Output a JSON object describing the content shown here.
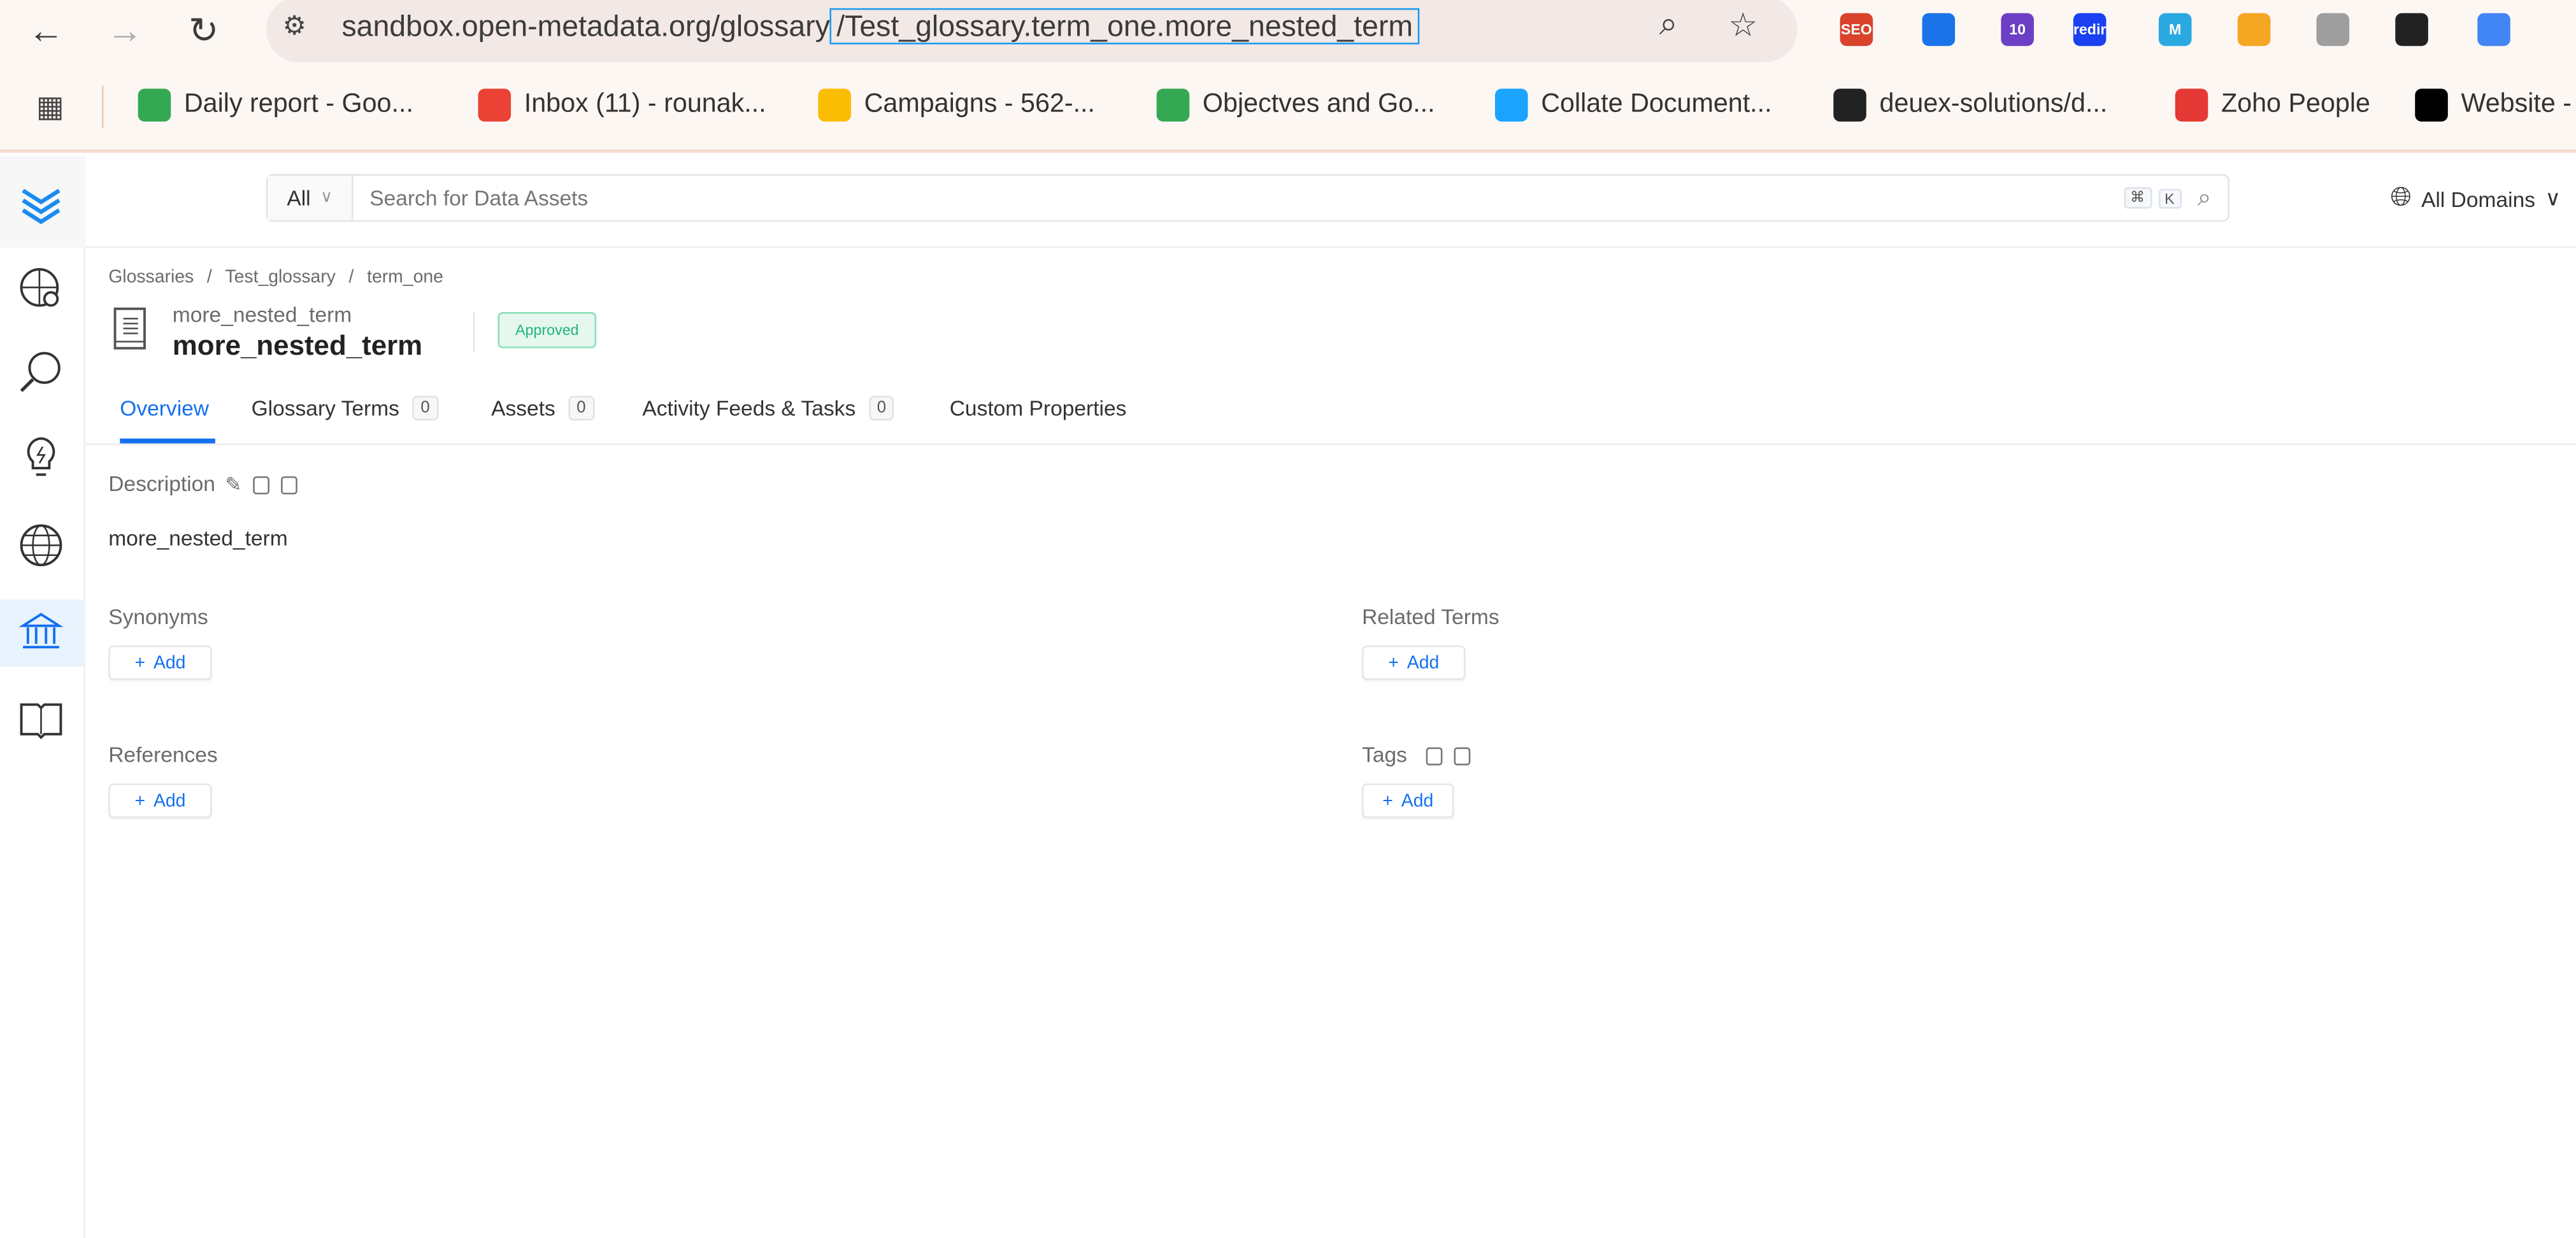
{
  "browser": {
    "url_host": "sandbox.open-metadata.org/glossary",
    "url_path": "/Test_glossary.term_one.more_nested_term",
    "extensions": [
      {
        "icon": "seo-extension-icon",
        "label": "SEO",
        "color": "#d9432b"
      },
      {
        "icon": "location-extension-icon",
        "label": "",
        "color": "#1a73e8"
      },
      {
        "icon": "badge-extension-icon",
        "label": "10",
        "color": "#6c3fc5"
      },
      {
        "icon": "redir-extension-icon",
        "label": "redir",
        "color": "#1a40f0"
      },
      {
        "icon": "m-extension-icon",
        "label": "M",
        "color": "#2aa9e0"
      },
      {
        "icon": "orange-extension-icon",
        "label": "",
        "color": "#f5a623"
      },
      {
        "icon": "gray-extension-icon",
        "label": "",
        "color": "#9e9e9e"
      },
      {
        "icon": "dark-extension-icon",
        "label": "",
        "color": "#222222"
      },
      {
        "icon": "sidepanel-icon",
        "label": "",
        "color": "#4285f4"
      }
    ],
    "bookmarks": [
      {
        "label": "Daily report - Goo...",
        "color": "#34a853"
      },
      {
        "label": "Inbox (11) - rounak...",
        "color": "#ea4335"
      },
      {
        "label": "Campaigns - 562-...",
        "color": "#fbbc04"
      },
      {
        "label": "Objectves and Go...",
        "color": "#34a853"
      },
      {
        "label": "Collate Document...",
        "color": "#1aa3ff"
      },
      {
        "label": "deuex-solutions/d...",
        "color": "#222222"
      },
      {
        "label": "Zoho People",
        "color": "#e53935"
      },
      {
        "label": "Website -",
        "color": "#000000"
      }
    ]
  },
  "header": {
    "search_scope": "All",
    "search_placeholder": "Search for Data Assets",
    "kbd_cmd": "⌘",
    "kbd_k": "K",
    "domains": "All Domains"
  },
  "breadcrumb": [
    "Glossaries",
    "Test_glossary",
    "term_one"
  ],
  "entity": {
    "display_small": "more_nested_term",
    "display_name": "more_nested_term",
    "status": "Approved",
    "status_color": "#1fb57a"
  },
  "tabs": [
    {
      "label": "Overview",
      "active": true
    },
    {
      "label": "Glossary Terms",
      "count": "0"
    },
    {
      "label": "Assets",
      "count": "0"
    },
    {
      "label": "Activity Feeds & Tasks",
      "count": "0"
    },
    {
      "label": "Custom Properties"
    }
  ],
  "overview": {
    "description_label": "Description",
    "description": "more_nested_term",
    "synonyms_label": "Synonyms",
    "related_label": "Related Terms",
    "references_label": "References",
    "tags_label": "Tags",
    "add_label": "Add"
  },
  "accent": "#1470ef"
}
